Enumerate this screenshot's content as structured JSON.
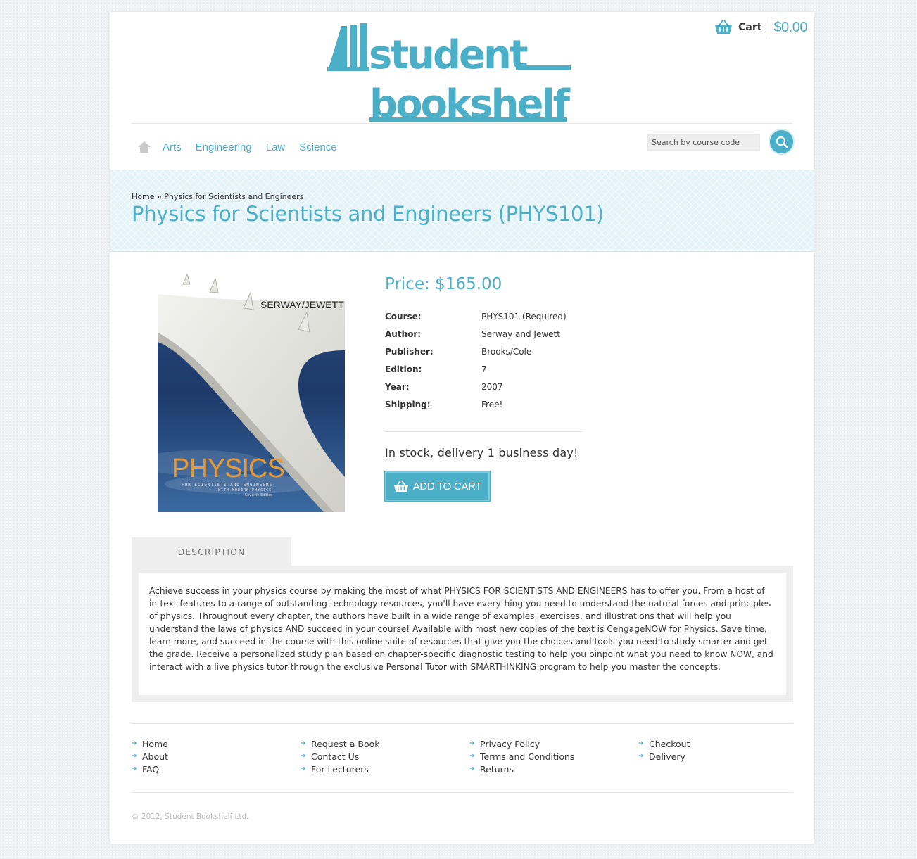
{
  "colors": {
    "accent": "#4bafc7",
    "text": "#333333",
    "panel": "#eeeeee"
  },
  "logo": {
    "line1": "student",
    "line2": "bookshelf"
  },
  "cart": {
    "label": "Cart",
    "total": "$0.00",
    "icon": "basket-icon"
  },
  "nav": {
    "home_icon": "home-icon",
    "links": [
      "Arts",
      "Engineering",
      "Law",
      "Science"
    ]
  },
  "search": {
    "placeholder": "Search by course code",
    "icon": "search-icon"
  },
  "breadcrumb": {
    "home": "Home",
    "separator": "»",
    "current": "Physics for Scientists and Engineers"
  },
  "page_title": "Physics for Scientists and Engineers (PHYS101)",
  "cover": {
    "authors": "SERWAY/JEWETT",
    "title": "PHYSICS",
    "subtitle1": "FOR SCIENTISTS AND ENGINEERS",
    "subtitle2": "WITH MODERN PHYSICS",
    "edition": "Seventh Edition"
  },
  "product": {
    "price": "Price: $165.00",
    "details": [
      {
        "label": "Course:",
        "value": "PHYS101 (Required)"
      },
      {
        "label": "Author:",
        "value": "Serway and Jewett"
      },
      {
        "label": "Publisher:",
        "value": "Brooks/Cole"
      },
      {
        "label": "Edition:",
        "value": "7"
      },
      {
        "label": "Year:",
        "value": "2007"
      },
      {
        "label": "Shipping:",
        "value": "Free!"
      }
    ],
    "stock": "In stock, delivery 1 business day!",
    "add_to_cart": "ADD TO CART"
  },
  "tabs": {
    "description": "DESCRIPTION"
  },
  "description": "Achieve success in your physics course by making the most of what PHYSICS FOR SCIENTISTS AND ENGINEERS has to offer you. From a host of in-text features to a range of outstanding technology resources, you'll have everything you need to understand the natural forces and principles of physics. Throughout every chapter, the authors have built in a wide range of examples, exercises, and illustrations that will help you understand the laws of physics AND succeed in your course! Available with most new copies of the text is CengageNOW for Physics. Save time, learn more, and succeed in the course with this online suite of resources that give you the choices and tools you need to study smarter and get the grade. Receive a personalized study plan based on chapter-specific diagnostic testing to help you pinpoint what you need to know NOW, and interact with a live physics tutor through the exclusive Personal Tutor with SMARTHINKING program to help you master the concepts.",
  "footer": {
    "columns": [
      [
        "Home",
        "About",
        "FAQ"
      ],
      [
        "Request a Book",
        "Contact Us",
        "For Lecturers"
      ],
      [
        "Privacy Policy",
        "Terms and Conditions",
        "Returns"
      ],
      [
        "Checkout",
        "Delivery"
      ]
    ],
    "copyright": "© 2012, Student Bookshelf Ltd."
  }
}
